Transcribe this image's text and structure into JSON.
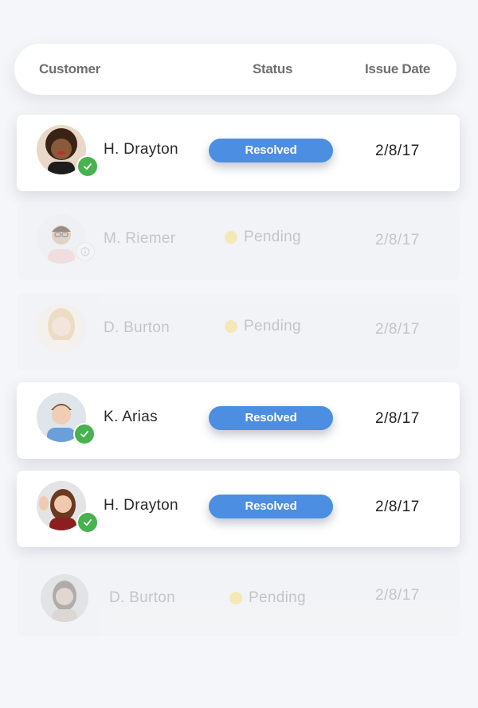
{
  "header": {
    "customer_label": "Customer",
    "status_label": "Status",
    "date_label": "Issue Date"
  },
  "colors": {
    "resolved_pill": "#4c8ee1",
    "success_badge": "#47b34f",
    "pending_dot": "#f5e08a",
    "muted_text": "#a9abb2"
  },
  "rows": [
    {
      "name": "H. Drayton",
      "status": "Resolved",
      "date": "2/8/17",
      "badge": "check-icon",
      "avatar": "avatar-woman-curly-hair"
    },
    {
      "name": "M. Riemer",
      "status": "Pending",
      "date": "2/8/17",
      "badge": "info-icon",
      "avatar": "avatar-man-glasses"
    },
    {
      "name": "D. Burton",
      "status": "Pending",
      "date": "2/8/17",
      "badge": "",
      "avatar": "avatar-woman-blonde"
    },
    {
      "name": "K. Arias",
      "status": "Resolved",
      "date": "2/8/17",
      "badge": "check-icon",
      "avatar": "avatar-man-blue-shirt"
    },
    {
      "name": "H. Drayton",
      "status": "Resolved",
      "date": "2/8/17",
      "badge": "check-icon",
      "avatar": "avatar-woman-waving"
    },
    {
      "name": "D. Burton",
      "status": "Pending",
      "date": "2/8/17",
      "badge": "",
      "avatar": "avatar-woman-portrait"
    }
  ]
}
